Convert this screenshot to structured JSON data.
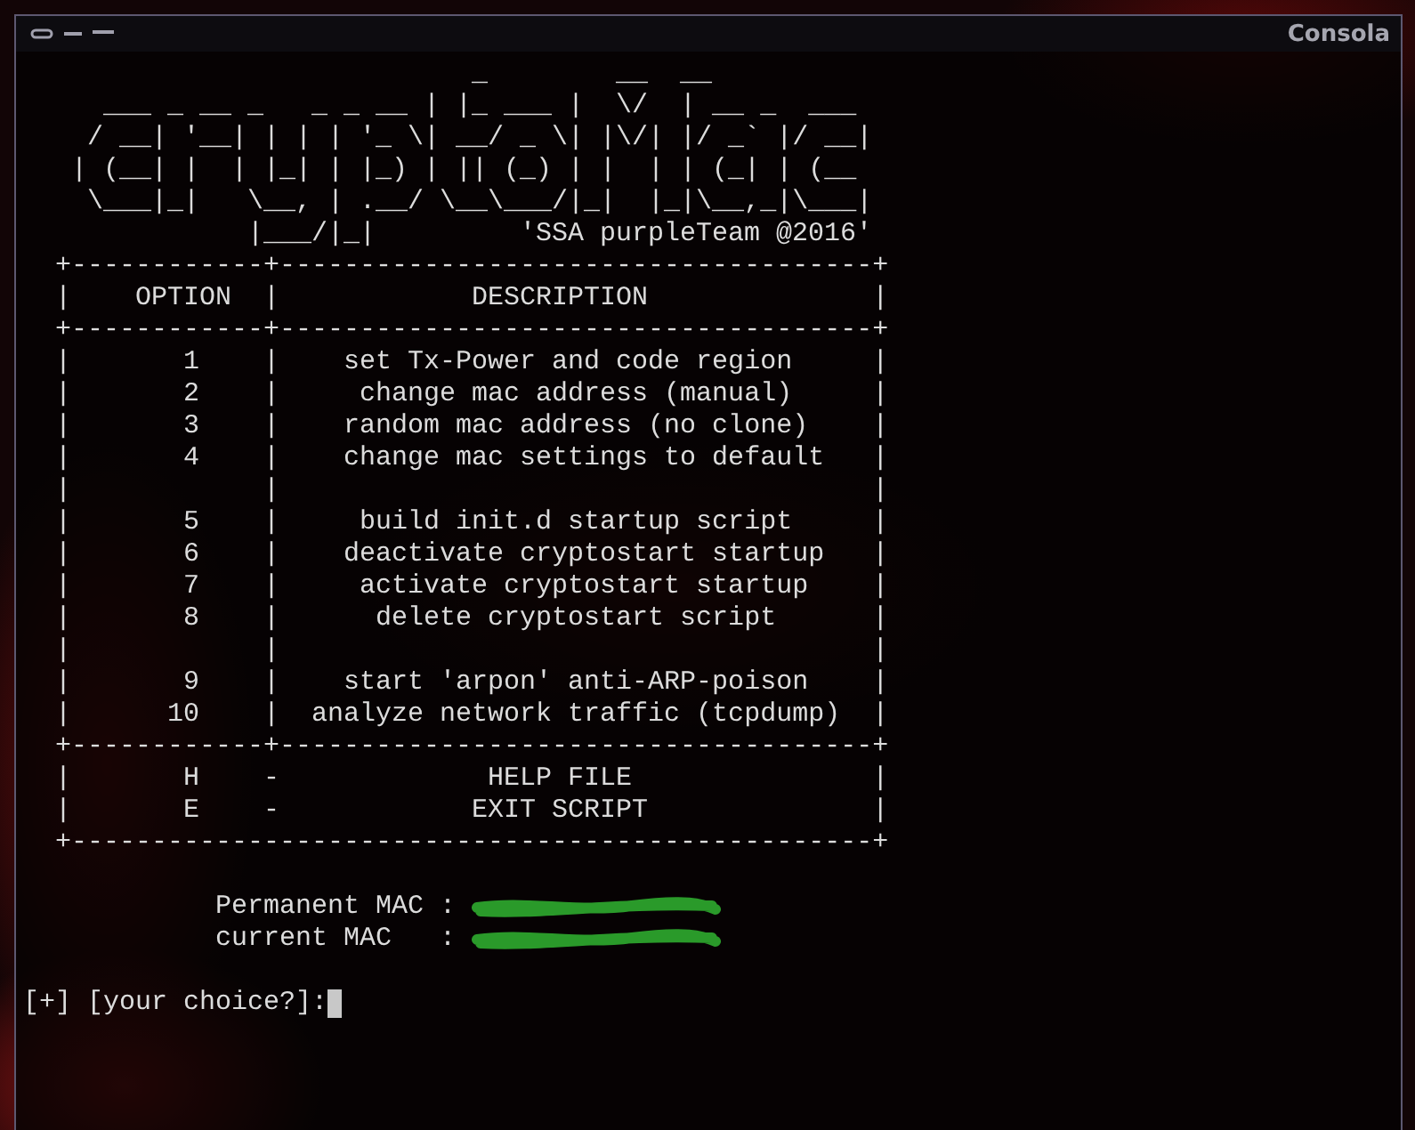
{
  "window": {
    "title": "Consola"
  },
  "banner": "                         _        __  __\n  ___ _ __ _   _ _ __ | |_ ___ |  \\/  | __ _  ___\n / __| '__| | | | '_ \\| __/ _ \\| |\\/| |/ _` |/ __|\n| (__| |  | |_| | |_) | || (_) | |  | | (_| | (__\n \\___|_|   \\__, | .__/ \\__\\___/|_|  |_|\\__,_|\\___|",
  "banner_tail": "|___/|_|",
  "credit": "'SSA purpleTeam @2016'",
  "table_lines": [
    "+------------+-------------------------------------+",
    "|    OPTION  |            DESCRIPTION              |",
    "+------------+-------------------------------------+",
    "|       1    |    set Tx-Power and code region     |",
    "|       2    |     change mac address (manual)     |",
    "|       3    |    random mac address (no clone)    |",
    "|       4    |    change mac settings to default   |",
    "|            |                                     |",
    "|       5    |     build init.d startup script     |",
    "|       6    |    deactivate cryptostart startup   |",
    "|       7    |     activate cryptostart startup    |",
    "|       8    |      delete cryptostart script      |",
    "|            |                                     |",
    "|       9    |    start 'arpon' anti-ARP-poison    |",
    "|      10    |  analyze network traffic (tcpdump)  |",
    "+------------+-------------------------------------+",
    "|       H    -             HELP FILE               |",
    "|       E    -            EXIT SCRIPT              |",
    "+--------------------------------------------------+"
  ],
  "mac_lines": [
    {
      "label": "Permanent MAC :"
    },
    {
      "label": "current MAC   :"
    }
  ],
  "prompt": "[+] [your choice?]:"
}
